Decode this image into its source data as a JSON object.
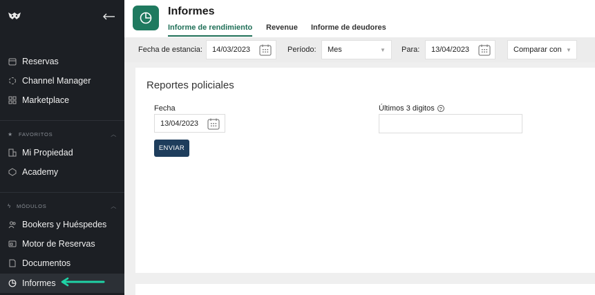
{
  "sidebar": {
    "items": [
      {
        "label": "Reservas",
        "icon": "calendar-icon"
      },
      {
        "label": "Channel Manager",
        "icon": "channel-icon"
      },
      {
        "label": "Marketplace",
        "icon": "grid-icon"
      }
    ],
    "favorites_label": "FAVORITOS",
    "favorites": [
      {
        "label": "Mi Propiedad",
        "icon": "property-icon"
      },
      {
        "label": "Academy",
        "icon": "academy-icon"
      }
    ],
    "modules_label": "MÓDULOS",
    "modules": [
      {
        "label": "Bookers y Huéspedes",
        "icon": "users-icon"
      },
      {
        "label": "Motor de Reservas",
        "icon": "engine-icon"
      },
      {
        "label": "Documentos",
        "icon": "document-icon"
      },
      {
        "label": "Informes",
        "icon": "report-icon",
        "active": true
      }
    ]
  },
  "header": {
    "title": "Informes",
    "tabs": [
      "Informe de rendimiento",
      "Revenue",
      "Informe de deudores"
    ],
    "active_tab": 0
  },
  "filters": {
    "stay_label": "Fecha de estancia:",
    "stay_date": "14/03/2023",
    "period_label": "Período:",
    "period_value": "Mes",
    "to_label": "Para:",
    "to_date": "13/04/2023",
    "compare_label": "Comparar con"
  },
  "report": {
    "title": "Reportes policiales",
    "date_label": "Fecha",
    "date_value": "13/04/2023",
    "digits_label": "Últimos 3 digitos",
    "digits_value": "",
    "submit_label": "ENVIAR"
  },
  "colors": {
    "accent": "#1f7a5f",
    "sidebar_bg": "#1c1f24",
    "button": "#1e3d5c",
    "arrow": "#1fd3a6"
  }
}
